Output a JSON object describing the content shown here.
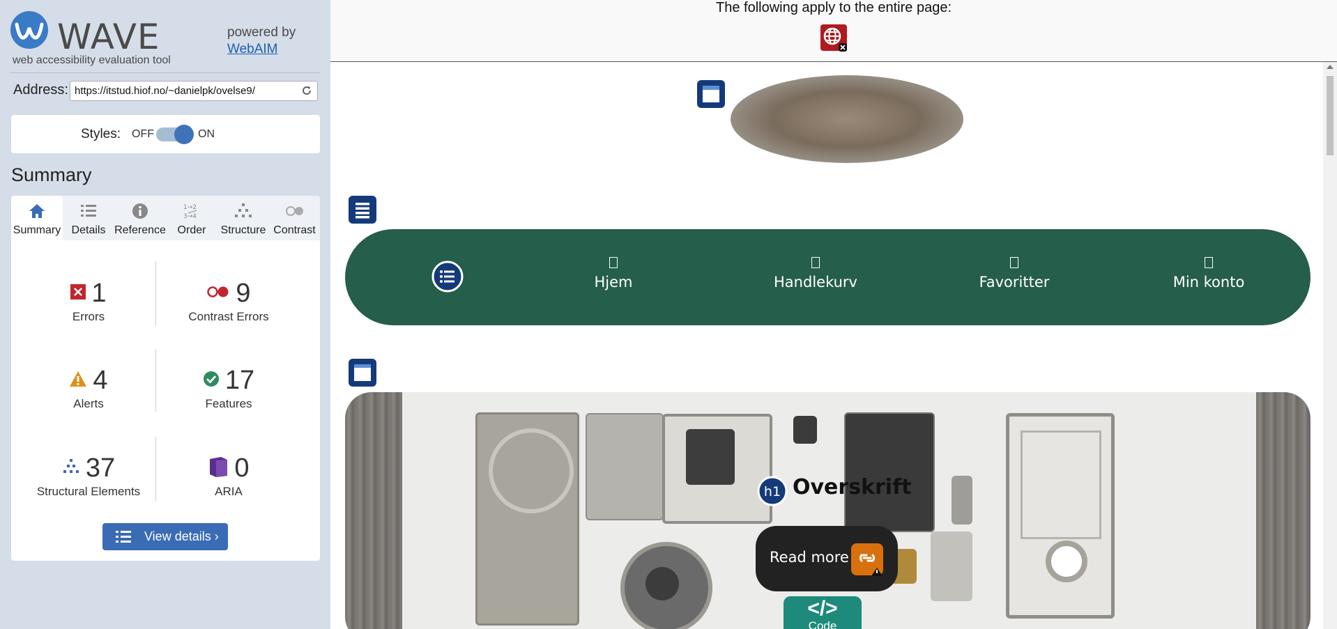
{
  "sidebar": {
    "logo_text": "WAVE",
    "tagline": "web accessibility evaluation tool",
    "powered_by": "powered by",
    "powered_link": "WebAIM",
    "address_label": "Address:",
    "address_value": "https://itstud.hiof.no/~danielpk/ovelse9/",
    "styles_label": "Styles:",
    "styles_off": "OFF",
    "styles_on": "ON",
    "styles_state": "on",
    "summary_heading": "Summary",
    "tabs": [
      {
        "label": "Summary",
        "icon": "home-icon",
        "active": true
      },
      {
        "label": "Details",
        "icon": "list-icon",
        "active": false
      },
      {
        "label": "Reference",
        "icon": "info-icon",
        "active": false
      },
      {
        "label": "Order",
        "icon": "order-icon",
        "active": false
      },
      {
        "label": "Structure",
        "icon": "structure-icon",
        "active": false
      },
      {
        "label": "Contrast",
        "icon": "contrast-icon",
        "active": false
      }
    ],
    "stats": {
      "errors": {
        "count": "1",
        "label": "Errors",
        "color": "#c0272d"
      },
      "contrast": {
        "count": "9",
        "label": "Contrast Errors",
        "color": "#c0272d"
      },
      "alerts": {
        "count": "4",
        "label": "Alerts",
        "color": "#e0901b"
      },
      "features": {
        "count": "17",
        "label": "Features",
        "color": "#2f8a5f"
      },
      "structural": {
        "count": "37",
        "label": "Structural Elements",
        "color": "#3a6cb5"
      },
      "aria": {
        "count": "0",
        "label": "ARIA",
        "color": "#5b2d8e"
      }
    },
    "view_details": "View details ›"
  },
  "page": {
    "top_notice": "The following apply to the entire page:",
    "nav_items": [
      "Hjem",
      "Handlekurv",
      "Favoritter",
      "Min konto"
    ],
    "heading": "Overskrift",
    "heading_badge": "h1",
    "read_more": "Read more",
    "code_badge_symbol": "</>",
    "code_badge_text": "Code",
    "nav_color": "#255e4a"
  }
}
